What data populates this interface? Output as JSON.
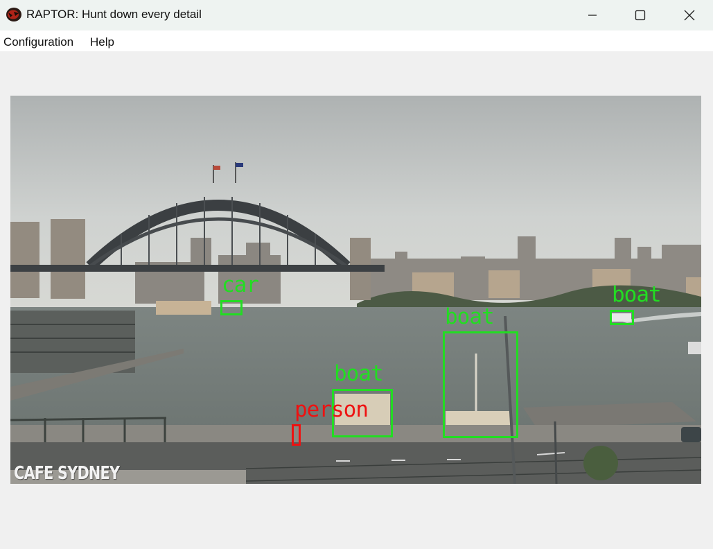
{
  "window": {
    "title": "RAPTOR: Hunt down every detail",
    "controls": {
      "minimize": "minimize-icon",
      "maximize": "maximize-icon",
      "close": "close-icon"
    }
  },
  "menu": {
    "items": [
      {
        "label": "Configuration"
      },
      {
        "label": "Help"
      }
    ]
  },
  "video": {
    "watermark": "CAFE SYDNEY",
    "detections": [
      {
        "label": "car",
        "color": "#22dd22"
      },
      {
        "label": "boat",
        "color": "#22dd22"
      },
      {
        "label": "boat",
        "color": "#22dd22"
      },
      {
        "label": "boat",
        "color": "#22dd22"
      },
      {
        "label": "person",
        "color": "#ee1111"
      }
    ]
  }
}
